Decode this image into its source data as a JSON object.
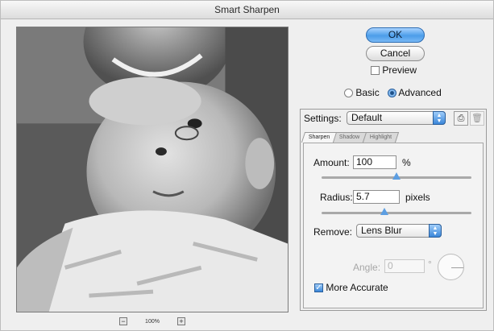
{
  "window": {
    "title": "Smart Sharpen"
  },
  "preview": {
    "zoom_level": "100%",
    "zoom_out_symbol": "−",
    "zoom_in_symbol": "+"
  },
  "buttons": {
    "ok": "OK",
    "cancel": "Cancel"
  },
  "preview_toggle": {
    "label": "Preview",
    "checked": false
  },
  "mode": {
    "basic_label": "Basic",
    "advanced_label": "Advanced",
    "selected": "Advanced"
  },
  "settings": {
    "label": "Settings:",
    "value": "Default",
    "save_icon": "save-settings-icon",
    "delete_icon": "trash-icon"
  },
  "tabs": [
    {
      "label": "Sharpen",
      "active": true
    },
    {
      "label": "Shadow",
      "active": false
    },
    {
      "label": "Highlight",
      "active": false
    }
  ],
  "sharpen": {
    "amount_label": "Amount:",
    "amount_value": "100",
    "amount_unit": "%",
    "amount_slider_fraction": 0.5,
    "radius_label": "Radius:",
    "radius_value": "5.7",
    "radius_unit": "pixels",
    "radius_slider_fraction": 0.42,
    "remove_label": "Remove:",
    "remove_value": "Lens Blur",
    "angle_label": "Angle:",
    "angle_value": "0",
    "angle_unit": "°",
    "more_accurate_label": "More Accurate",
    "more_accurate_checked": true
  },
  "colors": {
    "accent": "#4c9de9",
    "disabled_text": "#a7a7a7"
  }
}
